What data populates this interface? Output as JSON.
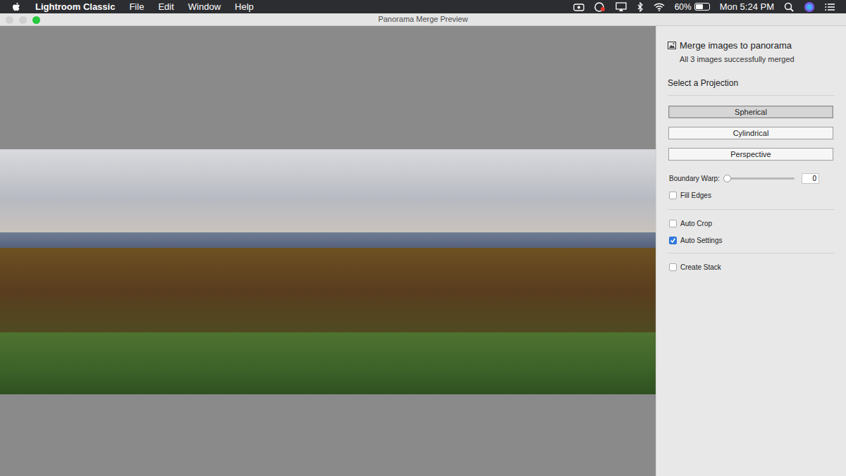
{
  "menubar": {
    "app": "Lightroom Classic",
    "menus": [
      "File",
      "Edit",
      "Window",
      "Help"
    ],
    "battery": "60%",
    "battery_level": 0.6,
    "clock": "Mon 5:24 PM"
  },
  "window": {
    "title": "Panorama Merge Preview"
  },
  "panel": {
    "heading": "Merge images to panorama",
    "status": "All 3 images successfully merged",
    "projection_label": "Select a Projection",
    "projections": [
      {
        "label": "Spherical",
        "selected": true
      },
      {
        "label": "Cylindrical",
        "selected": false
      },
      {
        "label": "Perspective",
        "selected": false
      }
    ],
    "boundary_warp": {
      "label": "Boundary Warp:",
      "level": 0,
      "value": "0"
    },
    "checkbox_groups": [
      [
        {
          "label": "Fill Edges",
          "checked": false
        }
      ],
      [
        {
          "label": "Auto Crop",
          "checked": false
        },
        {
          "label": "Auto Settings",
          "checked": true
        }
      ],
      [
        {
          "label": "Create Stack",
          "checked": false
        }
      ]
    ]
  }
}
